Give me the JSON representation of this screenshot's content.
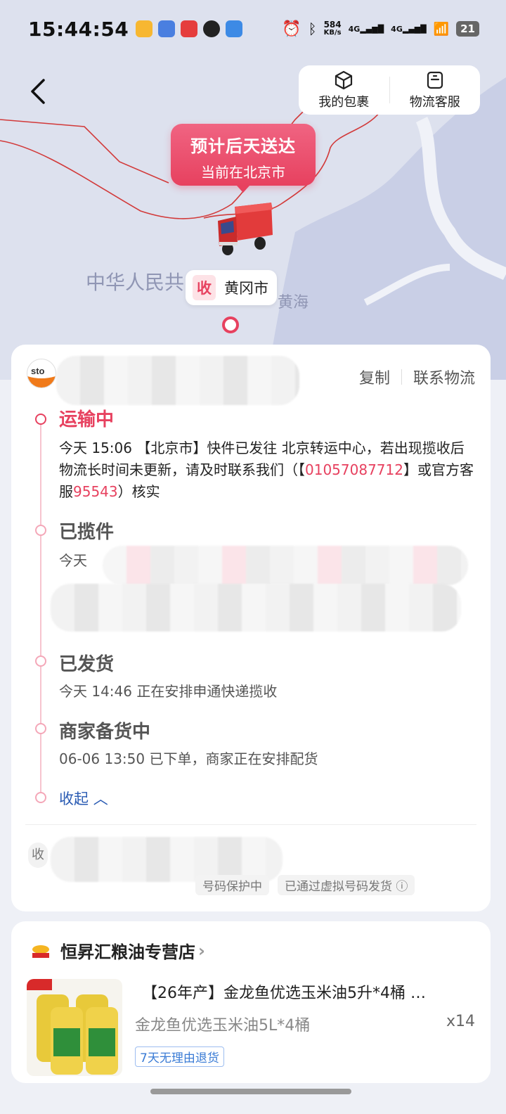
{
  "status_bar": {
    "time": "15:44:54",
    "net_speed": "584",
    "net_unit": "KB/s",
    "signal1": "4G",
    "signal2": "4G",
    "battery": "21"
  },
  "top_actions": {
    "package_label": "我的包裹",
    "service_label": "物流客服"
  },
  "map": {
    "eta_title": "预计后天送达",
    "eta_location": "当前在北京市",
    "dest_badge": "收",
    "dest_city": "黄冈市",
    "label_country": "中华人民共",
    "label_sea": "黄海"
  },
  "logistics": {
    "copy_label": "复制",
    "contact_label": "联系物流",
    "timeline": [
      {
        "title": "运输中",
        "text_pre": "今天 15:06 【北京市】快件已发往 北京转运中心，若出现揽收后物流长时间未更新，请及时联系我们（【",
        "phone": "01057087712",
        "text_mid": "】或官方客服",
        "hotline": "95543",
        "text_post": "）核实"
      },
      {
        "title": "已揽件",
        "text": "今天"
      },
      {
        "title": "已发货",
        "text": "今天 14:46  正在安排申通快递揽收"
      },
      {
        "title": "商家备货中",
        "text": "06-06 13:50  已下单，商家正在安排配货"
      }
    ],
    "collapse_label": "收起",
    "receiver_badge": "收",
    "privacy_tag": "号码保护中",
    "virtual_tag": "已通过虚拟号码发货"
  },
  "order": {
    "shop_name": "恒昇汇粮油专营店",
    "product_title": "【26年产】金龙鱼优选玉米油5升*4桶 …",
    "sku": "金龙鱼优选玉米油5L*4桶",
    "qty": "x14",
    "return_tag": "7天无理由退货"
  },
  "colors": {
    "accent": "#e7415f",
    "link": "#2a5bb3"
  }
}
